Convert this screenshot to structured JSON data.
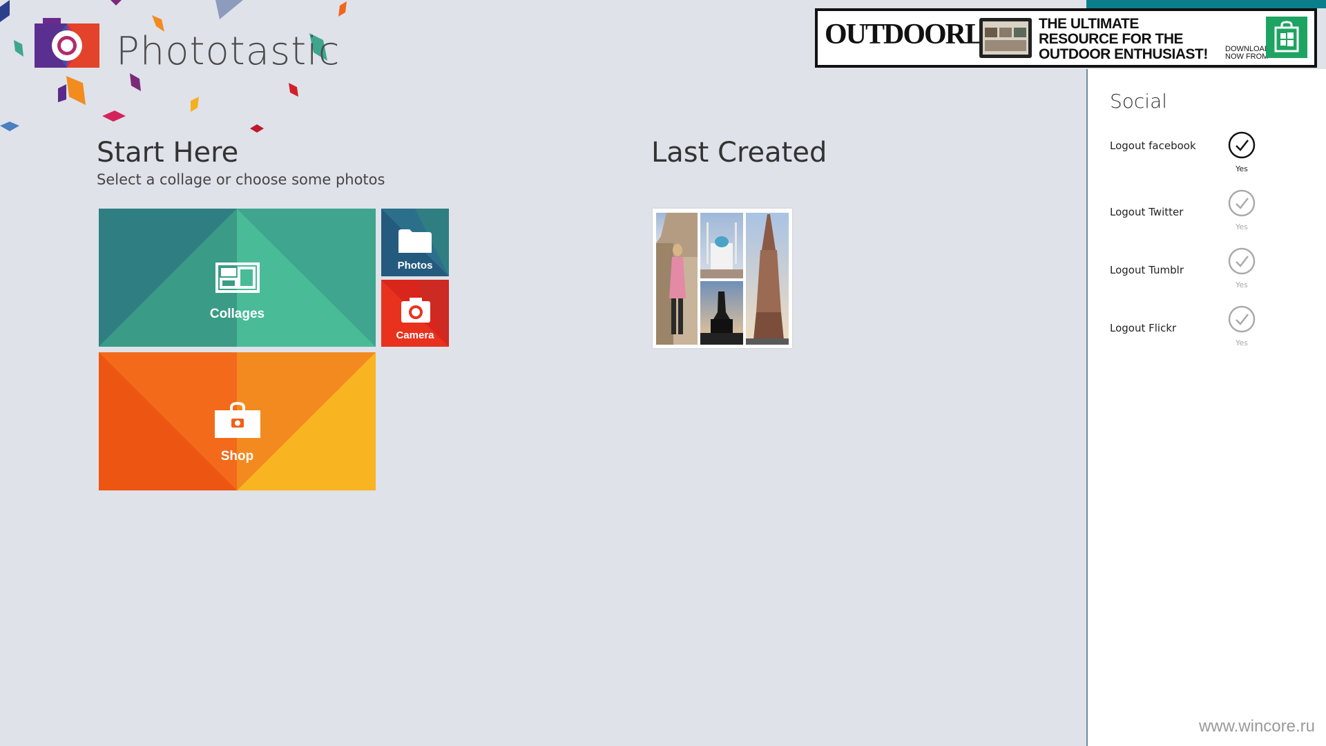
{
  "app": {
    "title": "Phototastic"
  },
  "start": {
    "title": "Start Here",
    "subtitle": "Select a collage or choose some photos",
    "tiles": {
      "collages": "Collages",
      "photos": "Photos",
      "camera": "Camera",
      "shop": "Shop"
    }
  },
  "last_created": {
    "title": "Last Created"
  },
  "ad": {
    "brand": "OUTDOORLIFE",
    "headline": "THE ULTIMATE\nRESOURCE FOR THE\nOUTDOOR ENTHUSIAST!",
    "download": "DOWNLOAD\nNOW FROM",
    "store_icon": "windows-store-icon"
  },
  "social": {
    "title": "Social",
    "items": [
      {
        "label": "Logout facebook",
        "state": "Yes",
        "active": true
      },
      {
        "label": "Logout Twitter",
        "state": "Yes",
        "active": false
      },
      {
        "label": "Logout Tumblr",
        "state": "Yes",
        "active": false
      },
      {
        "label": "Logout Flickr",
        "state": "Yes",
        "active": false
      }
    ]
  },
  "watermark": "www.wincore.ru",
  "colors": {
    "background": "#dfe2e9",
    "collages_tile": "#3fa58e",
    "photos_tile": "#245a7e",
    "camera_tile": "#e8321e",
    "shop_tile": "#f47a1f",
    "ad_store": "#1da462"
  }
}
